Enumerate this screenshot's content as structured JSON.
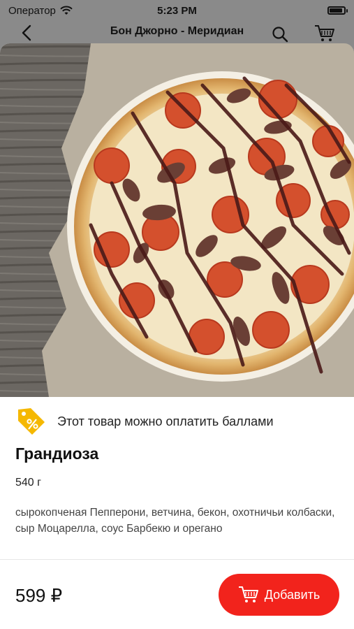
{
  "status_bar": {
    "carrier": "Оператор",
    "time": "5:23 PM"
  },
  "nav": {
    "title": "Бон Джорно - Меридиан"
  },
  "product": {
    "points_notice": "Этот товар можно оплатить баллами",
    "name": "Грандиоза",
    "weight": "540 г",
    "description": "сырокопченая Пепперони, ветчина, бекон, охотничьи колбаски,  сыр Моцарелла, соус Барбекю и орегано",
    "price": "599 ₽",
    "add_label": "Добавить"
  },
  "colors": {
    "accent": "#f2231c",
    "badge": "#f5b800"
  }
}
